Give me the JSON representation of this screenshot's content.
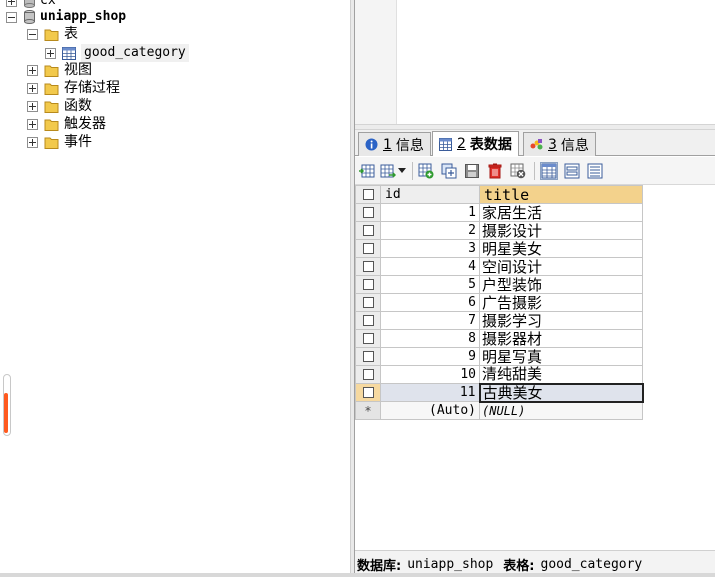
{
  "tree": {
    "connection_label": "cx",
    "database_label": "uniapp_shop",
    "tables_folder_label": "表",
    "table_label": "good_category",
    "views_label": "视图",
    "procedures_label": "存储过程",
    "functions_label": "函数",
    "triggers_label": "触发器",
    "events_label": "事件"
  },
  "tabs": [
    {
      "num": "1",
      "label": "信息",
      "icon": "info-icon"
    },
    {
      "num": "2",
      "label": "表数据",
      "icon": "table-data-icon"
    },
    {
      "num": "3",
      "label": "信息",
      "icon": "history-icon"
    }
  ],
  "toolbar": {
    "icons": [
      "insert-row-icon",
      "export-icon",
      "dropdown-arrow-icon",
      "add-row-icon",
      "duplicate-row-icon",
      "save-icon",
      "delete-icon",
      "cancel-icon",
      "grid-view-icon",
      "form-view-icon",
      "text-view-icon"
    ]
  },
  "grid": {
    "columns": [
      "id",
      "title"
    ],
    "rows": [
      {
        "id": "1",
        "title": "家居生活"
      },
      {
        "id": "2",
        "title": "摄影设计"
      },
      {
        "id": "3",
        "title": "明星美女"
      },
      {
        "id": "4",
        "title": "空间设计"
      },
      {
        "id": "5",
        "title": "户型装饰"
      },
      {
        "id": "6",
        "title": "广告摄影"
      },
      {
        "id": "7",
        "title": "摄影学习"
      },
      {
        "id": "8",
        "title": "摄影器材"
      },
      {
        "id": "9",
        "title": "明星写真"
      },
      {
        "id": "10",
        "title": "清纯甜美"
      },
      {
        "id": "11",
        "title": "古典美女"
      }
    ],
    "new_row": {
      "marker": "*",
      "id": "(Auto)",
      "title": "(NULL)"
    }
  },
  "status": {
    "db_label": "数据库:",
    "db_value": "uniapp_shop",
    "table_label": "表格:",
    "table_value": "good_category"
  },
  "colors": {
    "title_header": "#f3d28c",
    "scroll_accent": "#ff5a1f",
    "active_row": "#dfe3ec"
  }
}
